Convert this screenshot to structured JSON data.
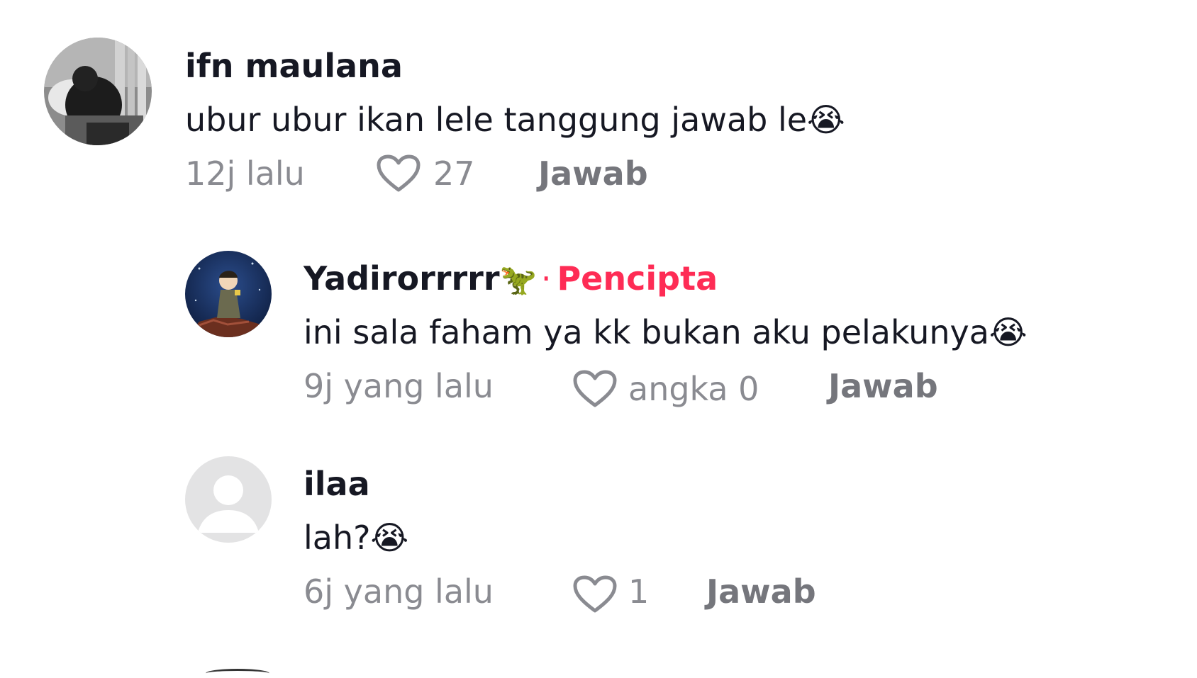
{
  "comments": [
    {
      "author": "ifn maulana",
      "text": "ubur ubur ikan lele tanggung jawab le😭",
      "time": "12j lalu",
      "likes": "27",
      "reply_label": "Jawab",
      "avatar": "photo-person-grayscale"
    },
    {
      "author": "Yadirorrrrr",
      "author_emoji": "🦖",
      "creator_sep": "·",
      "creator_label": "Pencipta",
      "text": "ini sala faham ya kk bukan aku pelakunya😭",
      "time": "9j yang lalu",
      "likes": "angka 0",
      "reply_label": "Jawab",
      "avatar": "anime-character-night-sky"
    },
    {
      "author": "ilaa",
      "text": "lah?😭",
      "time": "6j yang lalu",
      "likes": "1",
      "reply_label": "Jawab",
      "avatar": "default-user-icon"
    }
  ],
  "colors": {
    "text": "#161823",
    "meta": "#8a8b91",
    "creator": "#fe2c55",
    "background": "#ffffff"
  },
  "icons": [
    "heart-outline-icon",
    "default-user-icon"
  ]
}
